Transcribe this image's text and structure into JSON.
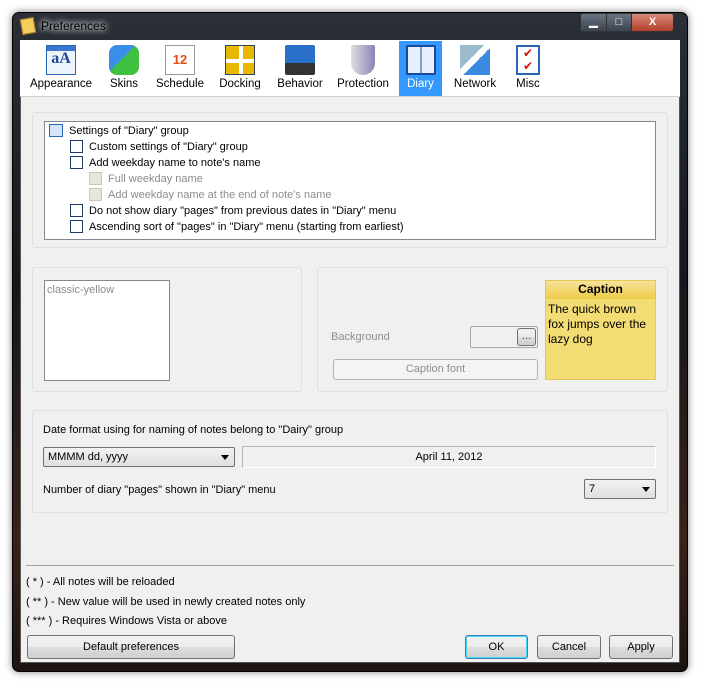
{
  "window": {
    "title": "Preferences",
    "minimize": "▁",
    "maximize": "□",
    "close": "X"
  },
  "toolbar": {
    "items": [
      {
        "label": "Appearance",
        "icon": "appearance-icon"
      },
      {
        "label": "Skins",
        "icon": "puzzle-icon"
      },
      {
        "label": "Schedule",
        "icon": "calendar-icon"
      },
      {
        "label": "Docking",
        "icon": "docking-icon"
      },
      {
        "label": "Behavior",
        "icon": "computer-icon"
      },
      {
        "label": "Protection",
        "icon": "shield-icon"
      },
      {
        "label": "Diary",
        "icon": "book-icon",
        "selected": true
      },
      {
        "label": "Network",
        "icon": "network-icon"
      },
      {
        "label": "Misc",
        "icon": "checklist-icon"
      }
    ]
  },
  "settings": {
    "header": "Settings of \"Diary\" group",
    "options": [
      {
        "label": "Custom settings of \"Diary\" group",
        "checked": false,
        "enabled": true
      },
      {
        "label": "Add weekday name to note's name",
        "checked": false,
        "enabled": true
      },
      {
        "label": "Full weekday name",
        "checked": false,
        "enabled": false
      },
      {
        "label": "Add weekday name at the end of note's name",
        "checked": false,
        "enabled": false
      },
      {
        "label": "Do not show diary \"pages\" from previous dates in \"Diary\" menu",
        "checked": false,
        "enabled": true
      },
      {
        "label": "Ascending sort of \"pages\" in \"Diary\" menu (starting from earliest)",
        "checked": false,
        "enabled": true
      }
    ]
  },
  "skins": {
    "items": [
      "classic-yellow"
    ]
  },
  "appearance": {
    "background_label": "Background",
    "browse": "...",
    "caption_font": "Caption font",
    "preview_caption": "Caption",
    "preview_text": "The quick brown fox jumps over the lazy dog",
    "preview_color": "#f3dc73"
  },
  "date": {
    "label": "Date format using for naming of notes belong to \"Dairy\" group",
    "format": "MMMM dd, yyyy",
    "preview": "April 11, 2012",
    "pages_label": "Number of diary \"pages\" shown in \"Diary\" menu",
    "pages": "7"
  },
  "notes": [
    "( * ) - All notes will be reloaded",
    "( ** ) - New value will be used in newly created notes only",
    "( *** ) - Requires Windows Vista or above"
  ],
  "buttons": {
    "default": "Default preferences",
    "ok": "OK",
    "cancel": "Cancel",
    "apply": "Apply"
  }
}
